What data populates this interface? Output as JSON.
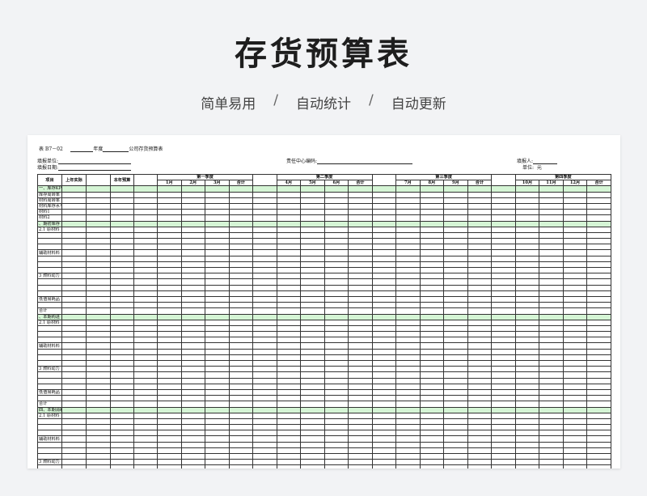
{
  "header": {
    "title": "存货预算表",
    "tags": [
      "简单易用",
      "自动统计",
      "自动更新"
    ],
    "sep": "/"
  },
  "sheet": {
    "form_no": "表 B7－02",
    "year_label": "年度",
    "company_label": "公司存货预算表",
    "unit_label": "填报单位:",
    "date_label": "填报日期:",
    "center_label": "责任中心编码:",
    "filler_label": "填报人:",
    "money_unit_label": "单位:",
    "money_unit": "元"
  },
  "table": {
    "head": {
      "item": "项目",
      "last_actual": "上年实际",
      "this_budget": "本年预算",
      "quarters": [
        "第一季度",
        "第二季度",
        "第三季度",
        "第四季度"
      ],
      "months": [
        "1月",
        "2月",
        "3月",
        "合计",
        "4月",
        "5月",
        "6月",
        "合计",
        "7月",
        "8月",
        "9月",
        "合计",
        "10月",
        "11月",
        "12月",
        "合计"
      ]
    },
    "rows": [
      {
        "label": "一、库存KPI总指标",
        "green": true
      },
      {
        "label": "库存周转率",
        "green": false
      },
      {
        "label": "材料周转率",
        "green": false
      },
      {
        "label": "材料库存水平",
        "green": false
      },
      {
        "label": "材料1",
        "green": false
      },
      {
        "label": "材料2",
        "green": false
      },
      {
        "label": "、期初库存",
        "green": true
      },
      {
        "label": "2.1 原材料",
        "green": false
      },
      {
        "label": "",
        "green": false
      },
      {
        "label": "",
        "green": false
      },
      {
        "label": "",
        "green": false
      },
      {
        "label": "辅助材料料",
        "green": false
      },
      {
        "label": "",
        "green": false
      },
      {
        "label": "",
        "green": false
      },
      {
        "label": "",
        "green": false
      },
      {
        "label": "3 燃料动力",
        "green": false
      },
      {
        "label": "",
        "green": false
      },
      {
        "label": "",
        "green": false
      },
      {
        "label": "",
        "green": false
      },
      {
        "label": "低值易耗品",
        "green": false
      },
      {
        "label": "",
        "green": false
      },
      {
        "label": "合计",
        "green": false
      },
      {
        "label": "、本期购进",
        "green": true
      },
      {
        "label": "2.1 原材料",
        "green": false
      },
      {
        "label": "",
        "green": false
      },
      {
        "label": "",
        "green": false
      },
      {
        "label": "",
        "green": false
      },
      {
        "label": "辅助材料料",
        "green": false
      },
      {
        "label": "",
        "green": false
      },
      {
        "label": "",
        "green": false
      },
      {
        "label": "",
        "green": false
      },
      {
        "label": "3 燃料动力",
        "green": false
      },
      {
        "label": "",
        "green": false
      },
      {
        "label": "",
        "green": false
      },
      {
        "label": "",
        "green": false
      },
      {
        "label": "低值易耗品",
        "green": false
      },
      {
        "label": "",
        "green": false
      },
      {
        "label": "合计",
        "green": false
      },
      {
        "label": "四、本期消耗领用",
        "green": true
      },
      {
        "label": "2.1 原材料",
        "green": false
      },
      {
        "label": "",
        "green": false
      },
      {
        "label": "",
        "green": false
      },
      {
        "label": "",
        "green": false
      },
      {
        "label": "辅助材料料",
        "green": false
      },
      {
        "label": "",
        "green": false
      },
      {
        "label": "",
        "green": false
      },
      {
        "label": "",
        "green": false
      },
      {
        "label": "3 燃料动力",
        "green": false
      },
      {
        "label": "",
        "green": false
      },
      {
        "label": "",
        "green": false
      }
    ]
  }
}
